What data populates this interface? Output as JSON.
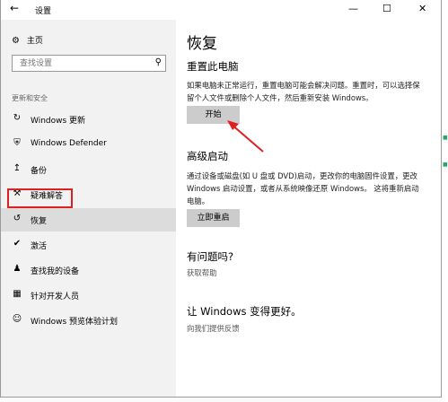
{
  "window": {
    "title": "设置",
    "back_icon": "arrow-left-icon",
    "minimize": "—",
    "maximize": "☐",
    "close": "✕"
  },
  "sidebar": {
    "home_label": "主页",
    "search_placeholder": "查找设置",
    "section_label": "更新和安全",
    "items": [
      {
        "label": "Windows 更新",
        "icon": "refresh-icon"
      },
      {
        "label": "Windows Defender",
        "icon": "shield-icon"
      },
      {
        "label": "备份",
        "icon": "upload-arrow-icon"
      },
      {
        "label": "疑难解答",
        "icon": "wrench-icon"
      },
      {
        "label": "恢复",
        "icon": "history-icon",
        "active": true
      },
      {
        "label": "激活",
        "icon": "check-circle-icon"
      },
      {
        "label": "查找我的设备",
        "icon": "person-location-icon"
      },
      {
        "label": "针对开发人员",
        "icon": "developer-icon"
      },
      {
        "label": "Windows 预览体验计划",
        "icon": "smiley-icon"
      }
    ]
  },
  "main": {
    "page_title": "恢复",
    "reset": {
      "heading": "重置此电脑",
      "desc": "如果电脑未正常运行，重置电脑可能会解决问题。重置时，可以选择保留个人文件或删除个人文件，然后重新安装 Windows。",
      "button": "开始"
    },
    "advanced": {
      "heading": "高级启动",
      "desc": "通过设备或磁盘(如 U 盘或 DVD)启动，更改你的电脑固件设置，更改 Windows 启动设置，或者从系统映像还原 Windows。 这将重新启动电脑。",
      "button": "立即重启"
    },
    "help": {
      "heading": "有问题吗?",
      "link": "获取帮助"
    },
    "feedback": {
      "heading": "让 Windows 变得更好。",
      "link": "向我们提供反馈"
    }
  },
  "colors": {
    "accent_red": "#e02020",
    "sidebar_bg": "#f2f2f2",
    "active_bg": "#dcdcdc",
    "button_bg": "#cccccc"
  }
}
